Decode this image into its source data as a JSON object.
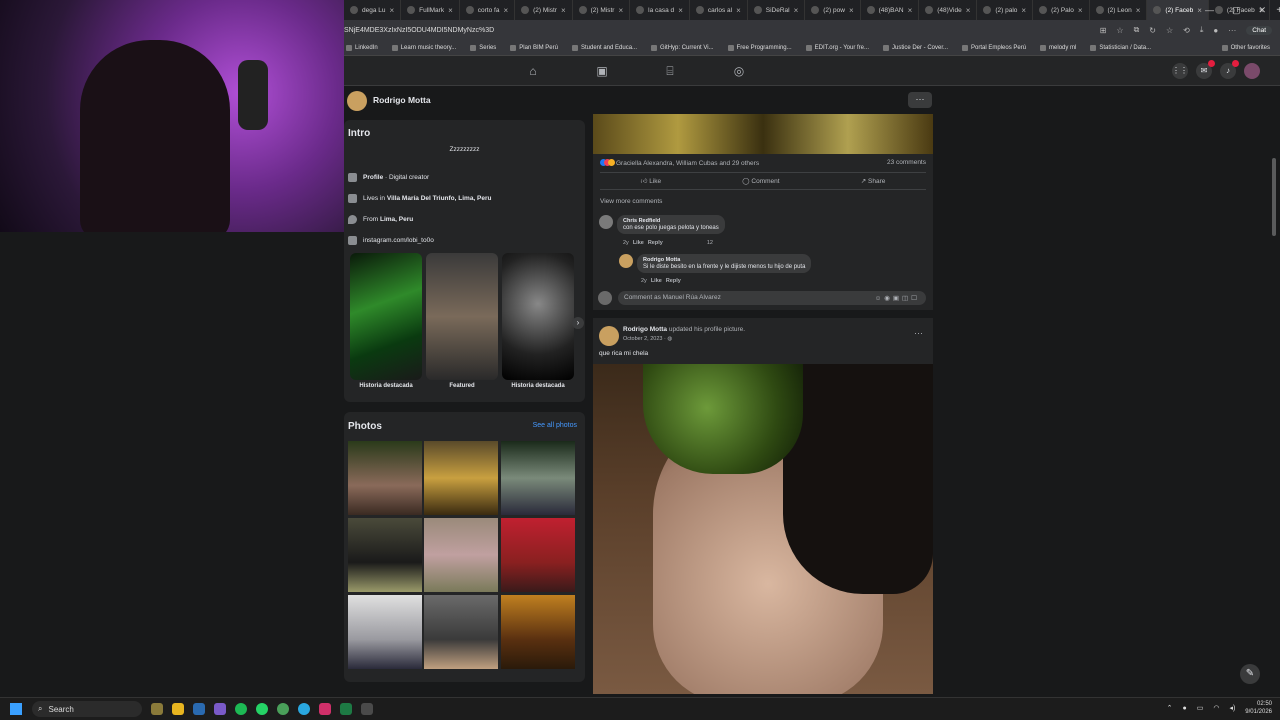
{
  "browser": {
    "tabs": [
      {
        "label": "dega Lu"
      },
      {
        "label": "FullMark"
      },
      {
        "label": "corto fa"
      },
      {
        "label": "(2) Mistr"
      },
      {
        "label": "(2) Mistr"
      },
      {
        "label": "la casa d"
      },
      {
        "label": "carlos al"
      },
      {
        "label": "SiDeRal"
      },
      {
        "label": "(2) pow"
      },
      {
        "label": "(48)BAN"
      },
      {
        "label": "(48)Vide"
      },
      {
        "label": "(2) palo"
      },
      {
        "label": "(2) Palo"
      },
      {
        "label": "(2) Leon"
      },
      {
        "label": "(2) Faceb"
      },
      {
        "label": "(2) Faceb"
      }
    ],
    "new_tab": "+",
    "window_controls": {
      "minimize": "—",
      "restore": "▢",
      "close": "✕"
    },
    "url": "SNjE4MDE3XzIxNzI5ODU4MDI5NDMyNzc%3D",
    "chat_label": "Chat",
    "bookmarks": [
      "LinkedIn",
      "Learn music theory...",
      "Series",
      "Plan BIM Perú",
      "Student and Educa...",
      "GitHyp: Current Vi...",
      "Free Programming...",
      "EDIT.org - Your fre...",
      "Justice Der - Cover...",
      "Portal Empleos Perú",
      "melody ml",
      "Statistician / Data..."
    ],
    "other_favorites": "Other favorites"
  },
  "profile": {
    "name": "Rodrigo Motta",
    "more": "···"
  },
  "intro": {
    "heading": "Intro",
    "bio": "Zzzzzzzzz",
    "category_label": "Profile",
    "category_value": " · Digital creator",
    "lives_label": "Lives in ",
    "lives_value": "Villa María Del Triunfo, Lima, Peru",
    "from_label": "From ",
    "from_value": "Lima, Peru",
    "link": "instagram.com/lobi_to0o",
    "highlights": [
      {
        "label": "Historia destacada"
      },
      {
        "label": "Featured"
      },
      {
        "label": "Historia destacada"
      }
    ],
    "next": "›"
  },
  "photos": {
    "heading": "Photos",
    "see_all": "See all photos"
  },
  "post1": {
    "reactions_text": "Graciella Alexandra, William Cubas and 29 others",
    "comment_count": "23 comments",
    "like": "Like",
    "comment": "Comment",
    "share": "Share",
    "view_more": "View more comments",
    "comment1_author": "Chris Redfield",
    "comment1_text": "con ese polo juegas pelota y toneas",
    "comment1_age": "2y",
    "comment1_like": "Like",
    "comment1_reply": "Reply",
    "comment1_reacts": "12",
    "reply_author": "Rodrigo Motta",
    "reply_text": "Si le diste besito en la frente y le dijiste menos tu hijo de puta",
    "reply_age": "2y",
    "reply_like": "Like",
    "reply_reply": "Reply",
    "compose_placeholder": "Comment as Manuel Rúa Alvarez"
  },
  "post2": {
    "author": "Rodrigo Motta",
    "action": " updated his profile picture.",
    "date": "October 2, 2023 · ",
    "more": "···",
    "caption": "que rica mi chela"
  },
  "taskbar": {
    "search": "Search",
    "time": "02:50",
    "date": "9/01/2026"
  }
}
